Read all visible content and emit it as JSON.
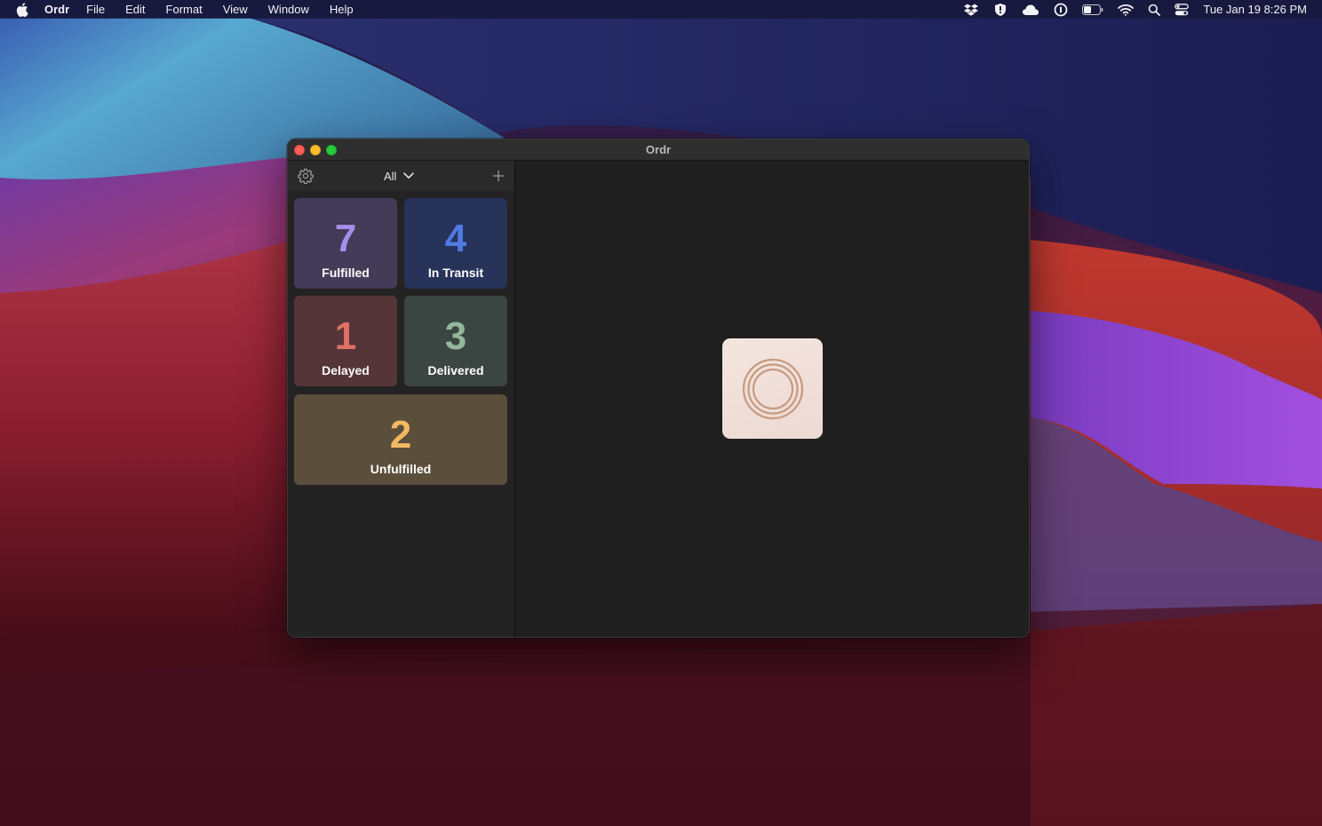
{
  "menubar": {
    "app_name": "Ordr",
    "menus": [
      "File",
      "Edit",
      "Format",
      "View",
      "Window",
      "Help"
    ],
    "status_icons": [
      "dropbox-icon",
      "shield-icon",
      "cloud-icon",
      "onepassword-icon",
      "battery-icon",
      "wifi-icon",
      "spotlight-icon",
      "control-center-icon"
    ],
    "clock": "Tue Jan 19  8:26 PM"
  },
  "window": {
    "title": "Ordr"
  },
  "sidebar": {
    "filter_label": "All",
    "tiles": [
      {
        "count": "7",
        "label": "Fulfilled",
        "color": "#a68eea"
      },
      {
        "count": "4",
        "label": "In Transit",
        "color": "#4f79e3"
      },
      {
        "count": "1",
        "label": "Delayed",
        "color": "#e07068"
      },
      {
        "count": "3",
        "label": "Delivered",
        "color": "#92b69e"
      },
      {
        "count": "2",
        "label": "Unfulfilled",
        "color": "#f2b862"
      }
    ]
  },
  "detail": {
    "logo_icon": "ordr-rings-icon",
    "logo_color": "#c79a80"
  }
}
